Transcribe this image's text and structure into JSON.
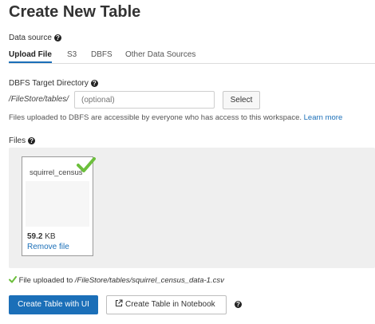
{
  "page_title": "Create New Table",
  "data_source": {
    "label": "Data source",
    "tabs": [
      {
        "label": "Upload File"
      },
      {
        "label": "S3"
      },
      {
        "label": "DBFS"
      },
      {
        "label": "Other Data Sources"
      }
    ]
  },
  "dbfs_target": {
    "label": "DBFS Target Directory",
    "path_prefix": "/FileStore/tables/",
    "placeholder": "(optional)",
    "select_label": "Select",
    "note": "Files uploaded to DBFS are accessible by everyone who has access to this workspace.",
    "learn_more": "Learn more"
  },
  "files": {
    "label": "Files",
    "file_name": "squirrel_census_data-1.csv",
    "file_size_value": "59.2",
    "file_size_unit": "KB",
    "remove_label": "Remove file"
  },
  "upload_status": {
    "text": "File uploaded to",
    "path": "/FileStore/tables/squirrel_census_data-1.csv"
  },
  "actions": {
    "create_ui": "Create Table with UI",
    "create_notebook": "Create Table in Notebook"
  },
  "colors": {
    "accent": "#1b6fb8",
    "success": "#6cbf3c"
  }
}
